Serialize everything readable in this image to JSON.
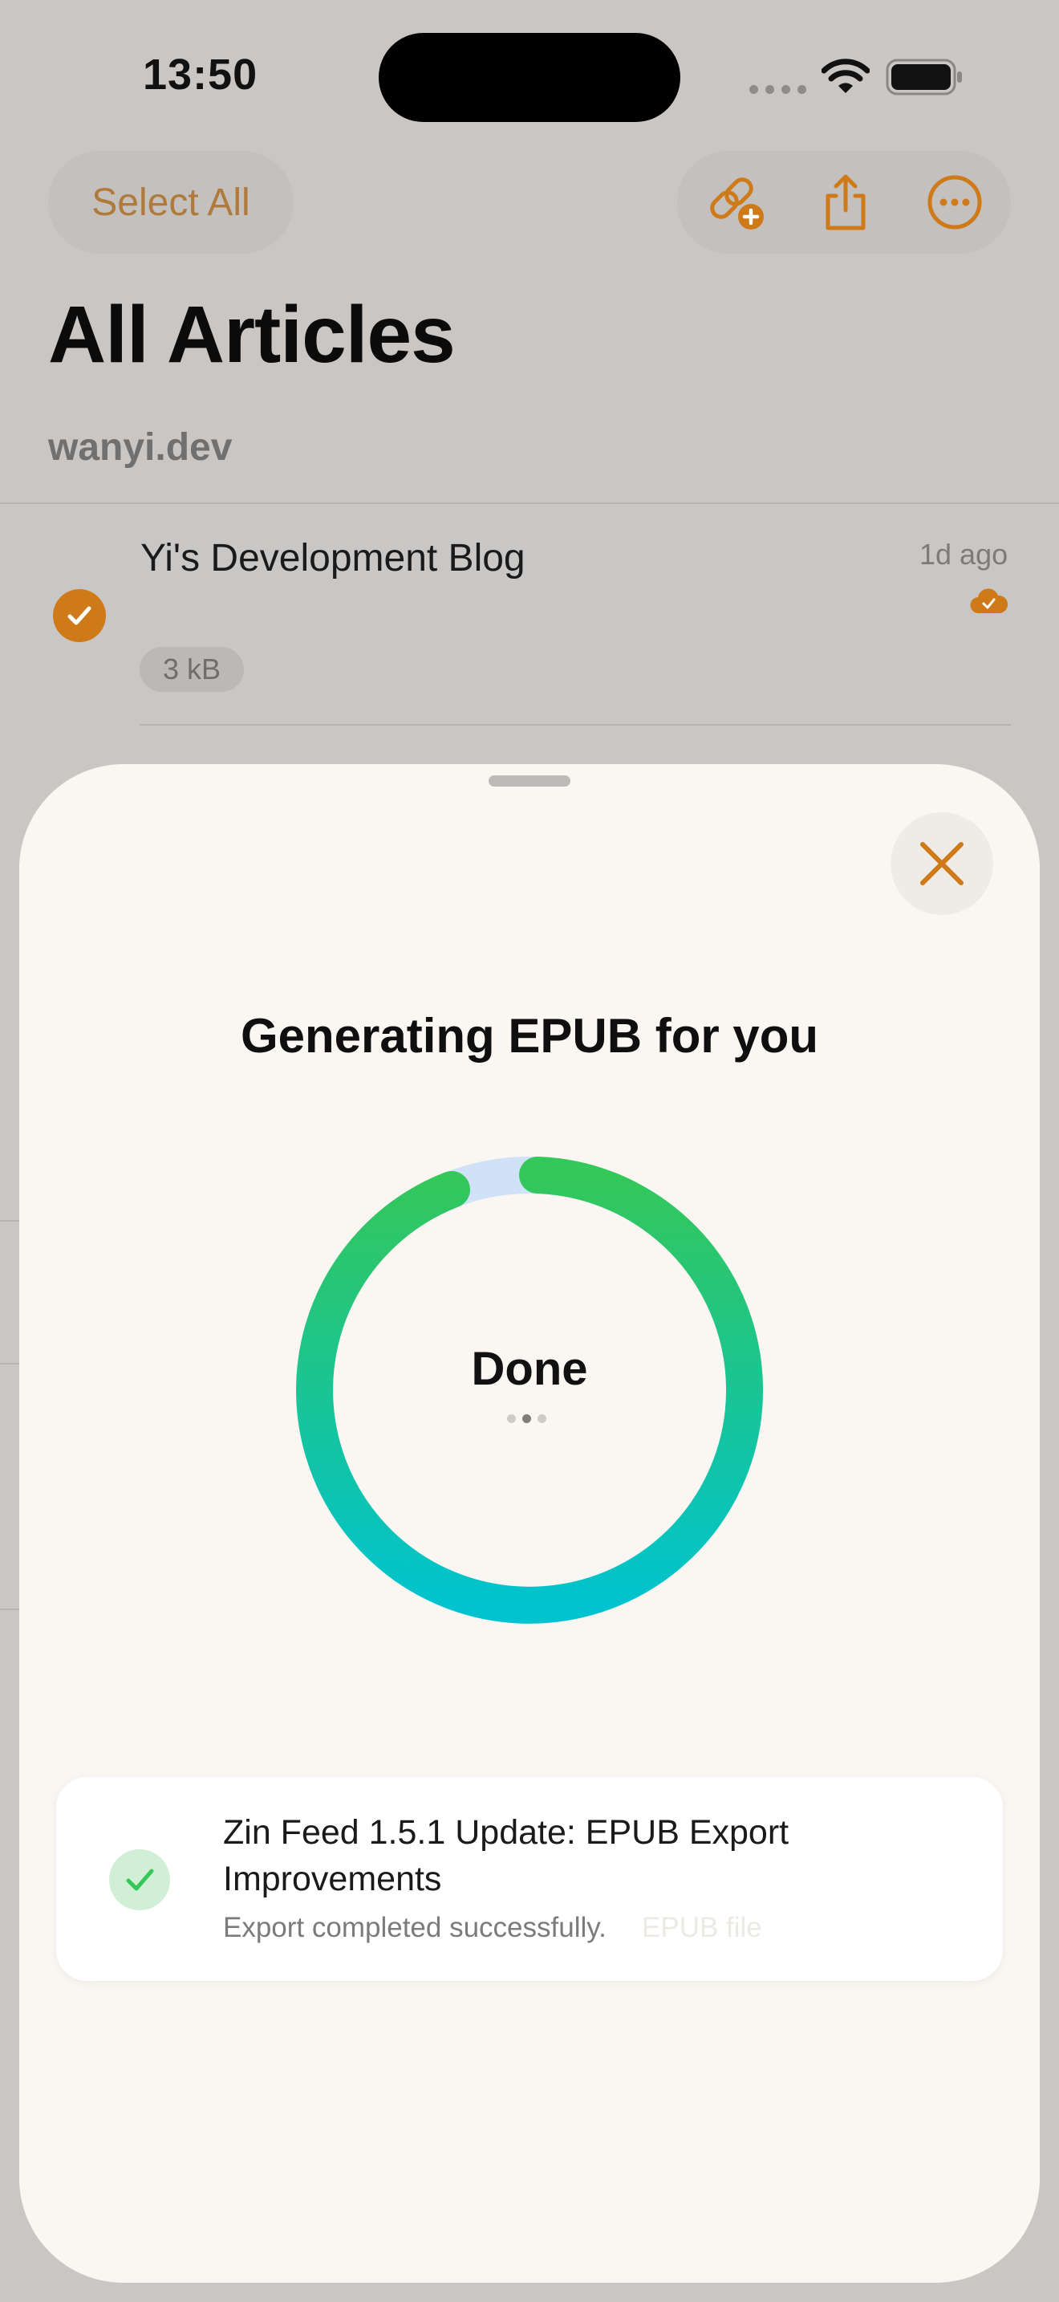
{
  "status_bar": {
    "time": "13:50"
  },
  "nav": {
    "select_all_label": "Select All",
    "icons": [
      "add-link-icon",
      "share-icon",
      "more-icon"
    ]
  },
  "page": {
    "title": "All Articles",
    "section_header": "wanyi.dev"
  },
  "articles": [
    {
      "title": "Yi's Development Blog",
      "time": "1d ago",
      "size": "3 kB",
      "selected": true,
      "synced": true
    }
  ],
  "sheet": {
    "title": "Generating EPUB for you",
    "progress_status": "Done",
    "notification": {
      "title": "Zin Feed 1.5.1 Update: EPUB Export Improvements",
      "subtitle": "Export completed successfully.",
      "faded_text": "EPUB file"
    }
  },
  "colors": {
    "accent": "#cf7a18",
    "ring_start": "#34c759",
    "ring_end": "#00c3cf",
    "ring_track": "#cfe2f7",
    "success": "#34c759"
  }
}
